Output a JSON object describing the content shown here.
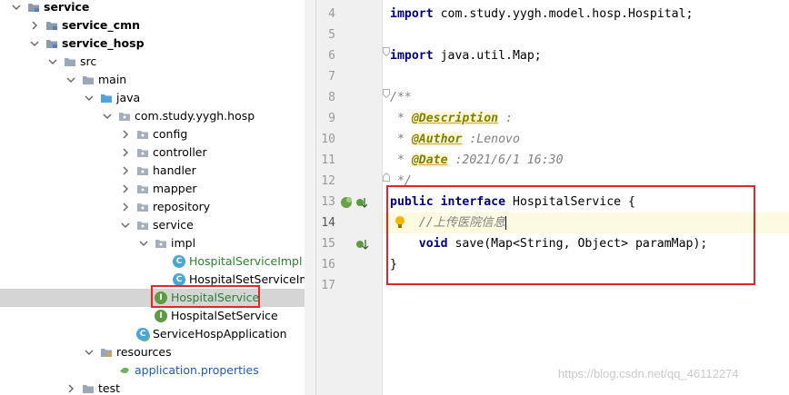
{
  "tree": {
    "items": [
      {
        "label": "service",
        "bold": true,
        "depth": 0,
        "expanded": true,
        "icon": "module-folder-icon"
      },
      {
        "label": "service_cmn",
        "bold": true,
        "depth": 1,
        "expanded": false,
        "icon": "module-folder-icon"
      },
      {
        "label": "service_hosp",
        "bold": true,
        "depth": 1,
        "expanded": true,
        "icon": "module-folder-icon"
      },
      {
        "label": "src",
        "depth": 2,
        "expanded": true,
        "icon": "folder-icon"
      },
      {
        "label": "main",
        "depth": 3,
        "expanded": true,
        "icon": "folder-icon"
      },
      {
        "label": "java",
        "depth": 4,
        "expanded": true,
        "icon": "source-folder-icon"
      },
      {
        "label": "com.study.yygh.hosp",
        "depth": 5,
        "expanded": true,
        "icon": "package-icon"
      },
      {
        "label": "config",
        "depth": 6,
        "expanded": false,
        "icon": "package-icon"
      },
      {
        "label": "controller",
        "depth": 6,
        "expanded": false,
        "icon": "package-icon"
      },
      {
        "label": "handler",
        "depth": 6,
        "expanded": false,
        "icon": "package-icon"
      },
      {
        "label": "mapper",
        "depth": 6,
        "expanded": false,
        "icon": "package-icon"
      },
      {
        "label": "repository",
        "depth": 6,
        "expanded": false,
        "icon": "package-icon"
      },
      {
        "label": "service",
        "depth": 6,
        "expanded": true,
        "icon": "package-icon"
      },
      {
        "label": "impl",
        "depth": 7,
        "expanded": true,
        "icon": "package-icon"
      },
      {
        "label": "HospitalServiceImpl",
        "depth": 8,
        "icon": "class-icon",
        "color": "green"
      },
      {
        "label": "HospitalSetServiceImpl",
        "depth": 8,
        "icon": "class-icon"
      },
      {
        "label": "HospitalService",
        "depth": 7,
        "icon": "interface-icon",
        "color": "green",
        "selected": true
      },
      {
        "label": "HospitalSetService",
        "depth": 7,
        "icon": "interface-icon"
      },
      {
        "label": "ServiceHospApplication",
        "depth": 6,
        "icon": "spring-class-icon"
      },
      {
        "label": "resources",
        "depth": 4,
        "expanded": true,
        "icon": "resources-folder-icon"
      },
      {
        "label": "application.properties",
        "depth": 5,
        "icon": "properties-file-icon",
        "color": "blue"
      },
      {
        "label": "test",
        "depth": 3,
        "expanded": false,
        "icon": "folder-icon"
      }
    ]
  },
  "editor": {
    "line_numbers": [
      "4",
      "5",
      "6",
      "7",
      "8",
      "9",
      "10",
      "11",
      "12",
      "13",
      "14",
      "15",
      "16",
      "17"
    ],
    "current_line": "14",
    "lines": {
      "l4_kw": "import",
      "l4_rest": " com.study.yygh.model.hosp.Hospital;",
      "l6_kw": "import",
      "l6_rest": " java.util.Map;",
      "l8": "/**",
      "l9_star": " * ",
      "l9_tag": "@Description",
      "l9_rest": " :",
      "l10_star": " * ",
      "l10_tag": "@Author",
      "l10_rest": " :Lenovo",
      "l11_star": " * ",
      "l11_tag": "@Date",
      "l11_rest": " :2021/6/1 16:30",
      "l12": " */",
      "l13_kw1": "public",
      "l13_kw2": "interface",
      "l13_rest": " HospitalService {",
      "l14_comment": "    //上传医院信息",
      "l15_kw": "    void",
      "l15_rest": " save(Map<String, Object> paramMap);",
      "l16": "}"
    }
  },
  "watermark": "https://blog.csdn.net/qq_46112274",
  "colors": {
    "highlight_box": "#e0282a",
    "keyword": "#000080",
    "comment": "#808080",
    "annotation": "#808000"
  }
}
